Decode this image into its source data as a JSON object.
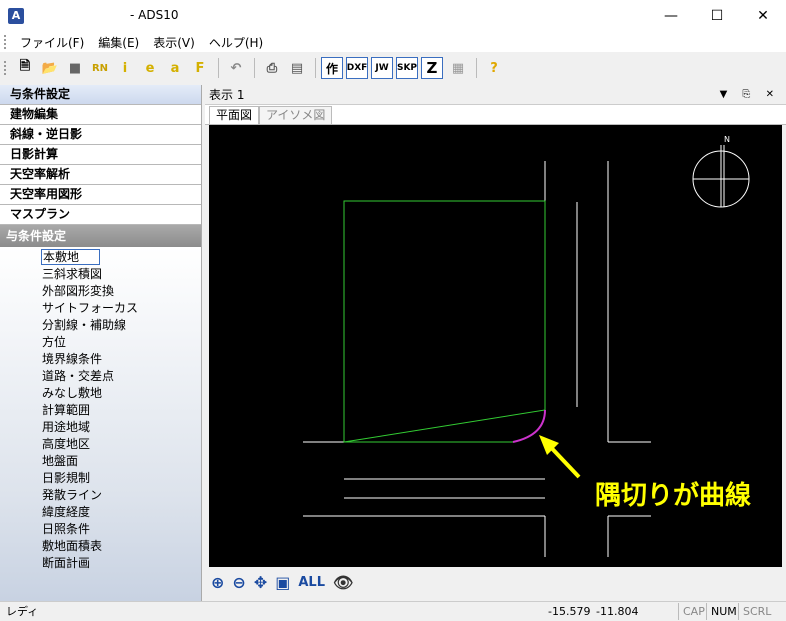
{
  "window": {
    "title": "- ADS10",
    "icon": "app-logo-icon",
    "controls": [
      "minimize-icon",
      "maximize-icon",
      "close-icon"
    ]
  },
  "menu": {
    "items": [
      "ファイル(F)",
      "編集(E)",
      "表示(V)",
      "ヘルプ(H)"
    ]
  },
  "toolbar": {
    "buttons": [
      "new-icon",
      "open-icon",
      "stop-icon",
      "rn-icon",
      "info-icon",
      "e-icon",
      "a-icon",
      "f-icon",
      "undo-icon",
      "print-icon",
      "settings-icon"
    ],
    "mode_buttons": [
      "作",
      "DXF",
      "JW",
      "SKP",
      "Z"
    ],
    "help_icon": "help-icon"
  },
  "categories": [
    "与条件設定",
    "建物編集",
    "斜線・逆日影",
    "日影計算",
    "天空率解析",
    "天空率用図形",
    "マスプラン"
  ],
  "section_header": "与条件設定",
  "tree_items": [
    "本敷地",
    "三斜求積図",
    "外部図形変換",
    "サイトフォーカス",
    "分割線・補助線",
    "方位",
    "境界線条件",
    "道路・交差点",
    "みなし敷地",
    "計算範囲",
    "用途地域",
    "高度地区",
    "地盤面",
    "日影規制",
    "発散ライン",
    "緯度経度",
    "日照条件",
    "敷地面積表",
    "断面計画"
  ],
  "document": {
    "title": "表示 1",
    "tabs": [
      "平面図",
      "アイソメ図"
    ],
    "compass_label": "N"
  },
  "zoom_tools": {
    "all_label": "ALL",
    "icons": [
      "zoom-in-icon",
      "zoom-out-icon",
      "pan-icon",
      "zoom-window-icon",
      "view-eye-icon"
    ]
  },
  "annotation": "隅切りが曲線",
  "status": {
    "ready": "レディ",
    "x": "-15.579",
    "y": "-11.804",
    "keys": [
      "CAP",
      "NUM",
      "SCRL"
    ]
  },
  "colors": {
    "canvas_bg": "#000000",
    "site_outline": "#33cc33",
    "arc": "#cc33cc",
    "annotation": "#ffff00"
  }
}
